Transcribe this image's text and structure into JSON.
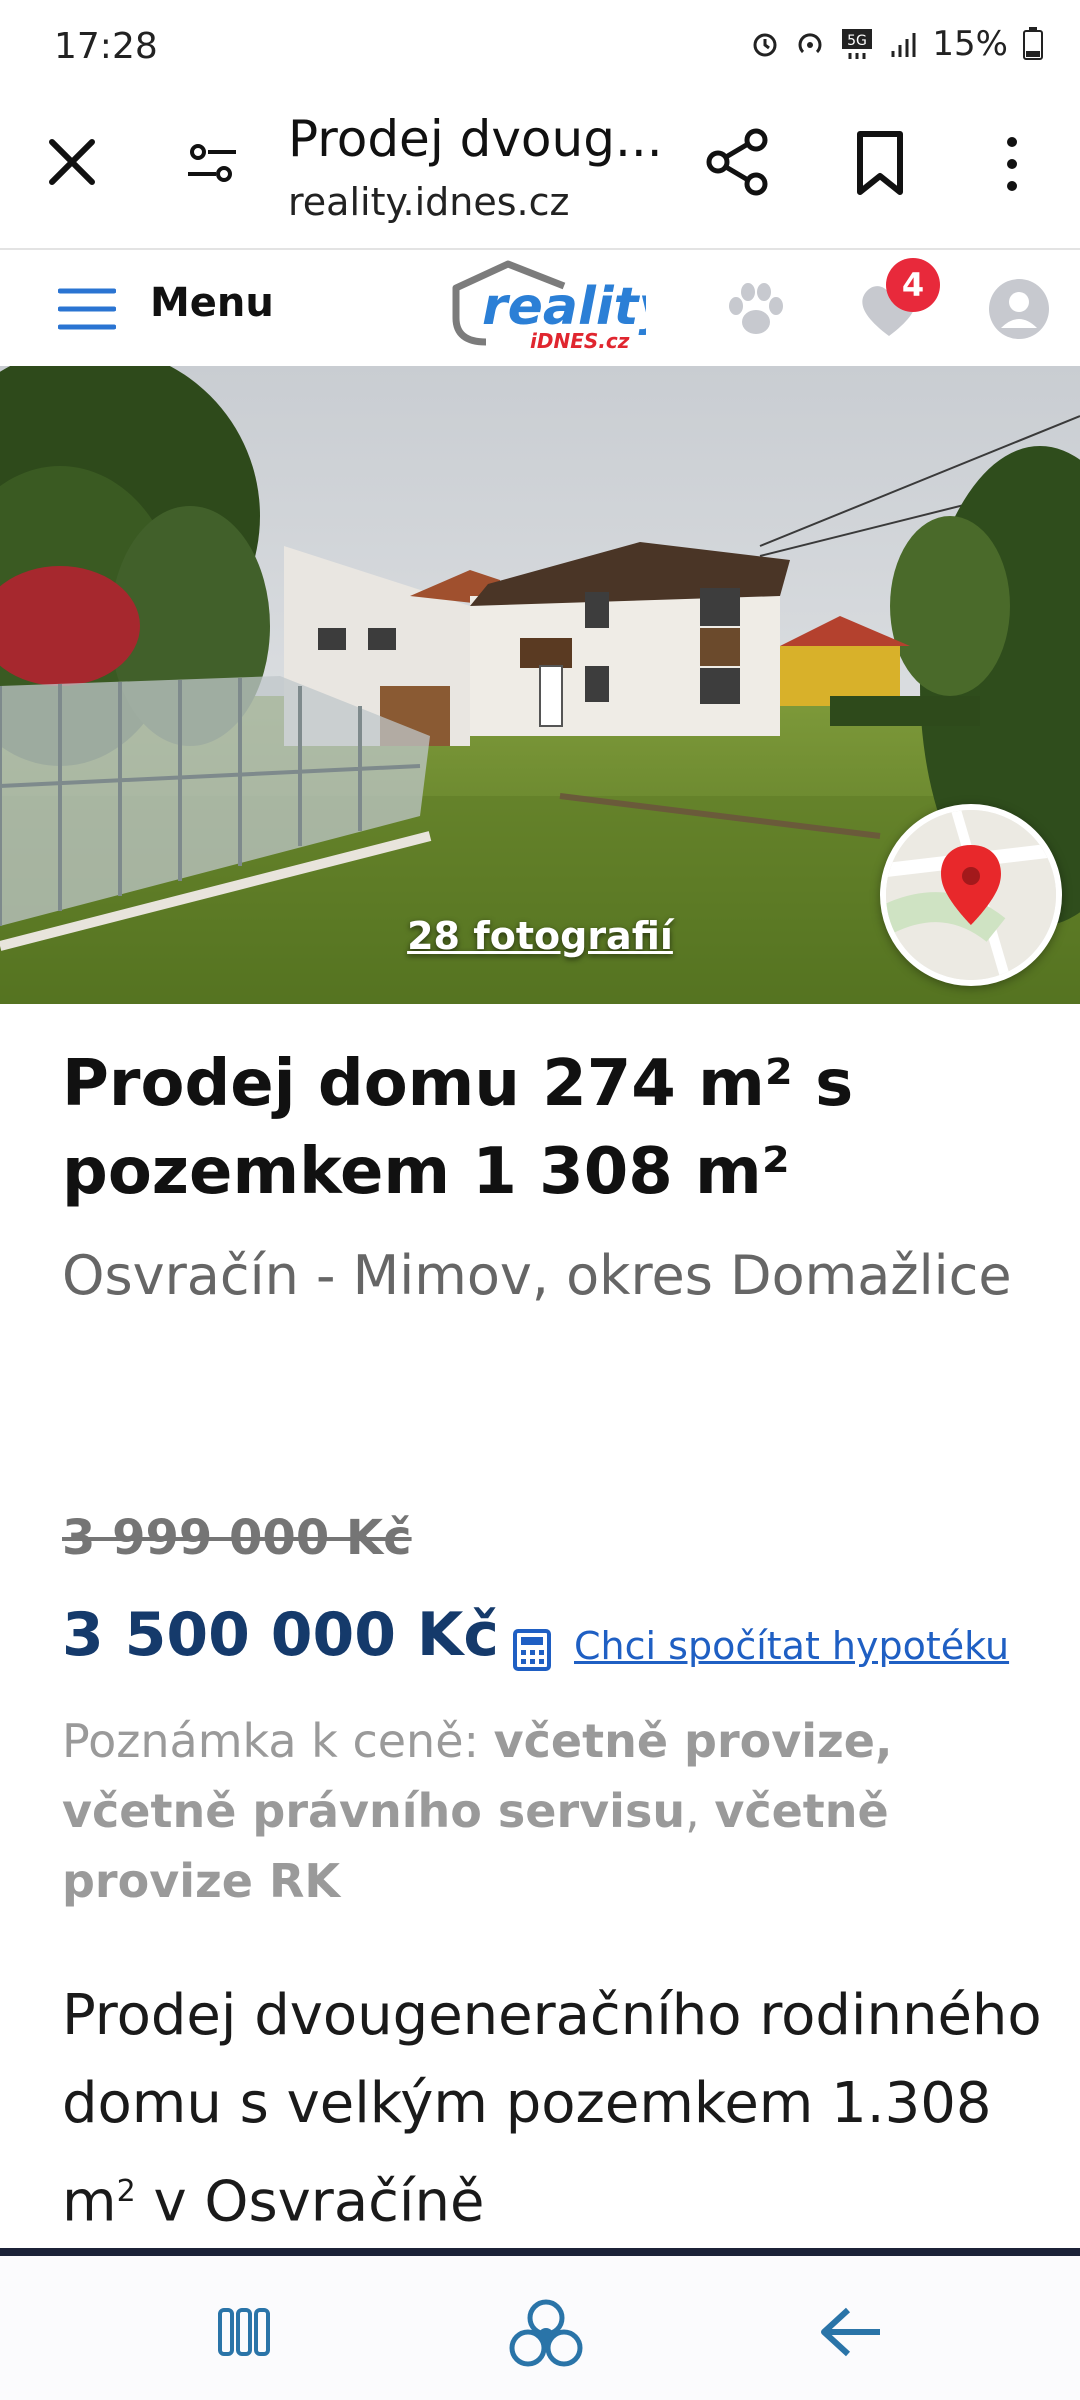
{
  "status_bar": {
    "time": "17:28",
    "battery": "15%",
    "icons": [
      "alarm-icon",
      "hotspot-icon",
      "5g-icon",
      "signal-icon",
      "battery-icon"
    ]
  },
  "browser": {
    "page_title": "Prodej dvoug...",
    "url": "reality.idnes.cz",
    "icons": [
      "close-icon",
      "tune-icon",
      "share-icon",
      "bookmark-icon",
      "more-icon"
    ]
  },
  "site_header": {
    "menu_label": "Menu",
    "logo_word": "reality",
    "logo_sub": "iDNES.cz",
    "favorites_count": "4"
  },
  "hero": {
    "photos_label": "28 fotografií"
  },
  "listing": {
    "title": "Prodej domu 274 m² s pozemkem 1 308 m²",
    "location": "Osvračín - Mimov, okres Domažlice",
    "old_price": "3 999 000 Kč",
    "price": "3 500 000 Kč",
    "mortgage_link": "Chci spočítat hypotéku",
    "note_label": "Poznámka k ceně:",
    "note_item_1": "včetně provize,",
    "note_item_2": "včetně právního servisu",
    "note_sep": ",",
    "note_item_3": "včetně provize RK",
    "desc_part1": "Prodej dvougeneračního rodinného domu s velkým pozemkem 1.308 m",
    "desc_sup": "2",
    "desc_part2": " v Osvračíně"
  },
  "colors": {
    "price": "#153a6b",
    "link": "#1f5fc3",
    "badge": "#e8293b",
    "menu_icon": "#2a74d2",
    "nav_icon": "#2a74a8"
  }
}
